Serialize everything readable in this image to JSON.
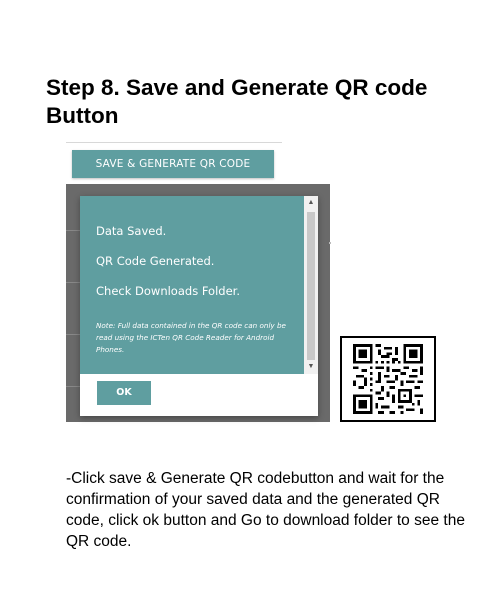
{
  "step": {
    "title": "Step 8. Save and Generate QR code Button"
  },
  "app": {
    "save_button_label": "SAVE & GENERATE QR CODE",
    "dialog": {
      "line1": "Data Saved.",
      "line2": "QR Code Generated.",
      "line3": "Check Downloads Folder.",
      "note": "Note: Full data contained in the QR code can only be read using the ICTen QR Code Reader for Android Phones.",
      "ok_label": "OK",
      "scroll_up_icon": "triangle-up-icon",
      "scroll_down_icon": "triangle-down-icon"
    }
  },
  "qr_code": {
    "icon": "qr-code-icon"
  },
  "instructions": {
    "text": "-Click save & Generate QR codebutton and wait for the confirmation of your saved data and the generated QR code, click ok button and  Go to download folder to see the QR code."
  },
  "colors": {
    "accent_teal": "#5f9ea0",
    "overlay_gray": "#6a6a6a",
    "page_background": "#ffffff"
  }
}
